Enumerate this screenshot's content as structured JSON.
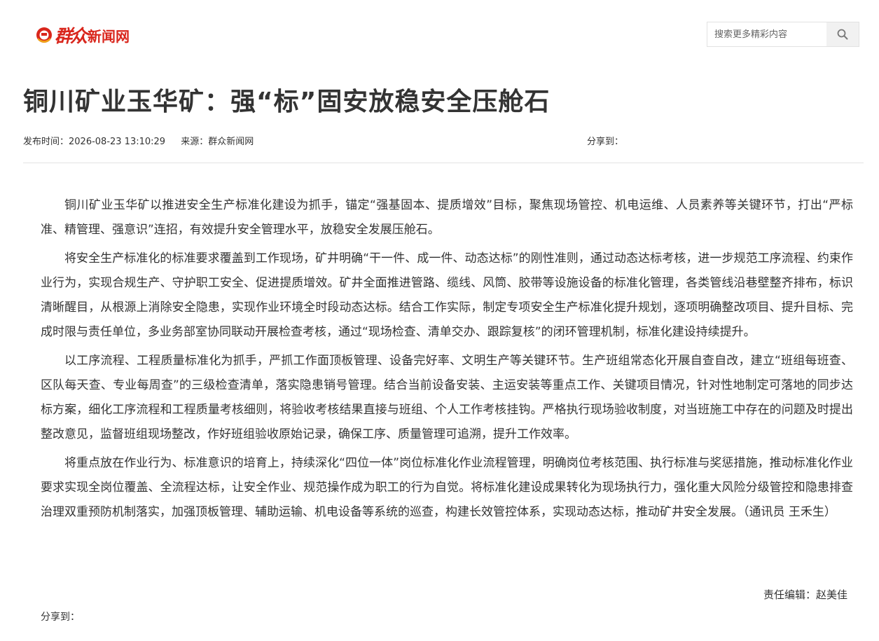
{
  "header": {
    "logo_calligraphy": "群众",
    "logo_text": "新闻网",
    "search_placeholder": "搜索更多精彩内容",
    "brand_color": "#d9261c"
  },
  "article": {
    "title": "铜川矿业玉华矿：强“标”固安放稳安全压舱石",
    "publish_time": "发布时间：2026-08-23 13:10:29",
    "source": "来源：群众新闻网",
    "share_label": "分享到：",
    "paragraphs": [
      "铜川矿业玉华矿以推进安全生产标准化建设为抓手，锚定“强基固本、提质增效”目标，聚焦现场管控、机电运维、人员素养等关键环节，打出“严标准、精管理、强意识”连招，有效提升安全管理水平，放稳安全发展压舱石。",
      "将安全生产标准化的标准要求覆盖到工作现场，矿井明确“干一件、成一件、动态达标”的刚性准则，通过动态达标考核，进一步规范工序流程、约束作业行为，实现合规生产、守护职工安全、促进提质增效。矿井全面推进管路、缆线、风筒、胶带等设施设备的标准化管理，各类管线沿巷壁整齐排布，标识清晰醒目，从根源上消除安全隐患，实现作业环境全时段动态达标。结合工作实际，制定专项安全生产标准化提升规划，逐项明确整改项目、提升目标、完成时限与责任单位，多业务部室协同联动开展检查考核，通过“现场检查、清单交办、跟踪复核”的闭环管理机制，标准化建设持续提升。",
      "以工序流程、工程质量标准化为抓手，严抓工作面顶板管理、设备完好率、文明生产等关键环节。生产班组常态化开展自查自改，建立“班组每班查、区队每天查、专业每周查”的三级检查清单，落实隐患销号管理。结合当前设备安装、主运安装等重点工作、关键项目情况，针对性地制定可落地的同步达标方案，细化工序流程和工程质量考核细则，将验收考核结果直接与班组、个人工作考核挂钩。严格执行现场验收制度，对当班施工中存在的问题及时提出整改意见，监督班组现场整改，作好班组验收原始记录，确保工序、质量管理可追溯，提升工作效率。",
      "将重点放在作业行为、标准意识的培育上，持续深化“四位一体”岗位标准化作业流程管理，明确岗位考核范围、执行标准与奖惩措施，推动标准化作业要求实现全岗位覆盖、全流程达标，让安全作业、规范操作成为职工的行为自觉。将标准化建设成果转化为现场执行力，强化重大风险分级管控和隐患排查治理双重预防机制落实，加强顶板管理、辅助运输、机电设备等系统的巡查，构建长效管控体系，实现动态达标，推动矿井安全发展。（通讯员 王禾生）"
    ],
    "editor": "责任编辑：赵美佳",
    "share_bottom": "分享到："
  }
}
